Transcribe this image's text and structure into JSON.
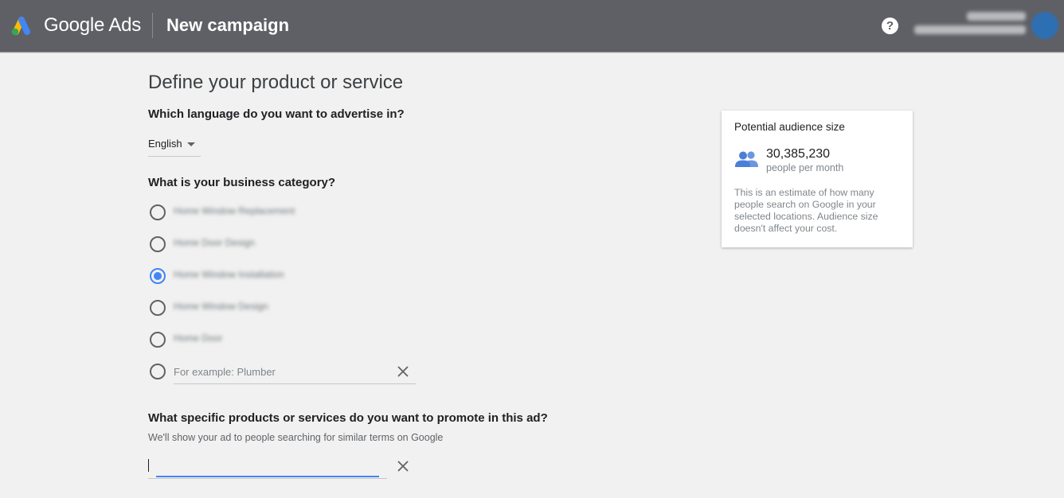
{
  "header": {
    "product_name": "Google Ads",
    "page_title": "New campaign",
    "help_glyph": "?",
    "icons": [
      "google-ads-logo-icon",
      "help-icon",
      "account-avatar"
    ]
  },
  "form": {
    "section_title": "Define your product or service",
    "language": {
      "question": "Which language do you want to advertise in?",
      "selected": "English"
    },
    "category": {
      "question": "What is your business category?",
      "options": [
        {
          "label": "Home Window Replacement",
          "checked": false
        },
        {
          "label": "Home Door Design",
          "checked": false
        },
        {
          "label": "Home Window Installation",
          "checked": true
        },
        {
          "label": "Home Window Design",
          "checked": false
        },
        {
          "label": "Home Door",
          "checked": false
        }
      ],
      "custom_placeholder": "For example: Plumber"
    },
    "products": {
      "question": "What specific products or services do you want to promote in this ad?",
      "helper": "We'll show your ad to people searching for similar terms on Google",
      "value": ""
    }
  },
  "audience": {
    "title": "Potential audience size",
    "count": "30,385,230",
    "unit": "people per month",
    "note": "This is an estimate of how many people search on Google in your selected locations. Audience size doesn't affect your cost."
  },
  "colors": {
    "topbar": "#5f6066",
    "accent": "#4285f4",
    "background": "#f1f1f1"
  }
}
